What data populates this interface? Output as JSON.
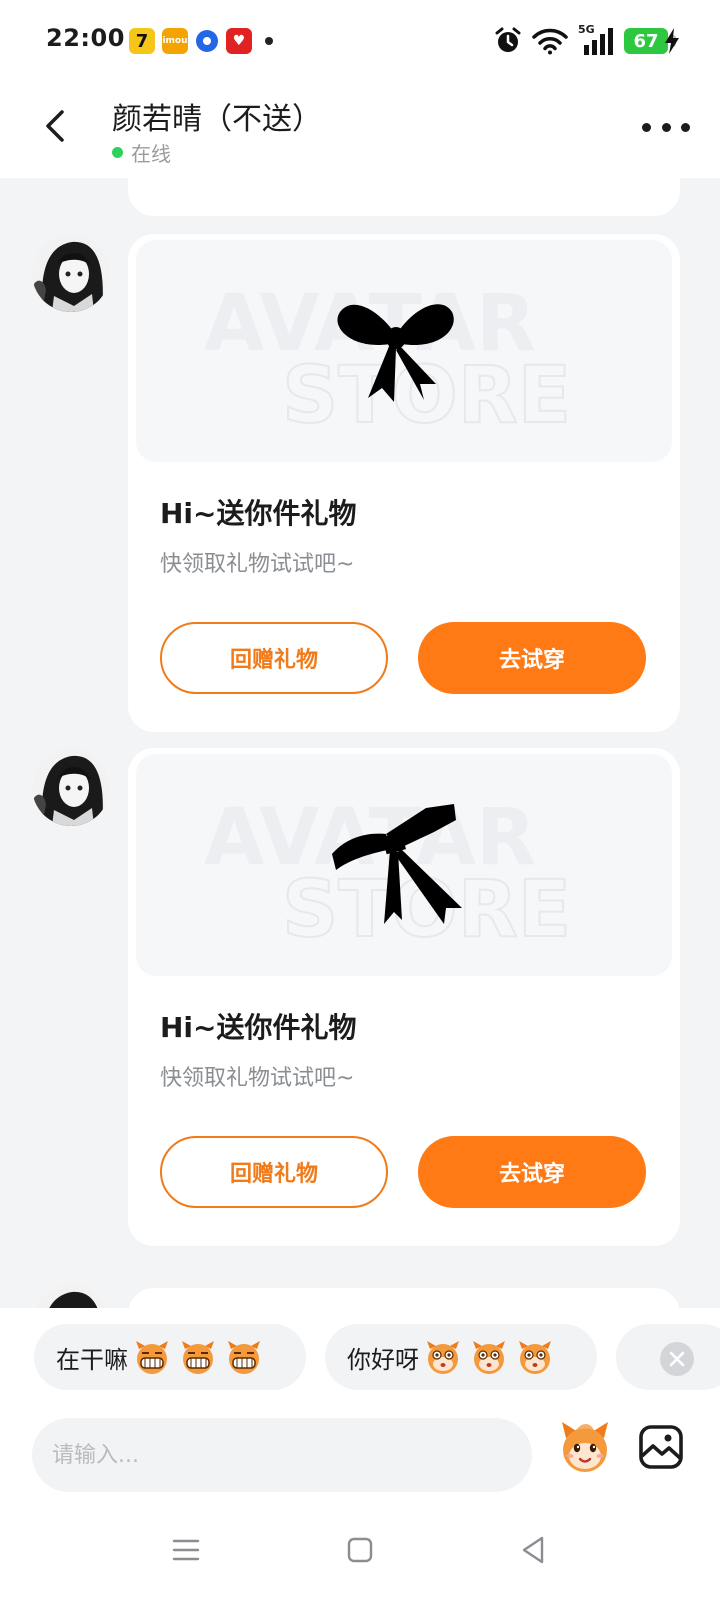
{
  "status_bar": {
    "time": "22:00",
    "notif_app1": "7",
    "notif_app2": "imou",
    "notif_app4": "♥",
    "network_label": "5G",
    "battery": "67"
  },
  "header": {
    "title": "颜若晴（不送）",
    "status": "在线"
  },
  "messages": [
    {
      "watermark_line1": "AVATAR",
      "watermark_line2": "STORE",
      "title": "Hi~送你件礼物",
      "subtitle": "快领取礼物试试吧~",
      "secondary_button": "回赠礼物",
      "primary_button": "去试穿"
    },
    {
      "watermark_line1": "AVATAR",
      "watermark_line2": "STORE",
      "title": "Hi~送你件礼物",
      "subtitle": "快领取礼物试试吧~",
      "secondary_button": "回赠礼物",
      "primary_button": "去试穿"
    }
  ],
  "quick_replies": [
    {
      "text": "在干嘛"
    },
    {
      "text": "你好呀"
    }
  ],
  "composer": {
    "placeholder": "请输入..."
  },
  "colors": {
    "accent": "#ff7a14",
    "online": "#2fd15a",
    "battery": "#2ec840"
  },
  "icons": [
    "back-arrow-icon",
    "more-dots-icon",
    "bow-icon",
    "emoji-sticker-icon",
    "image-icon",
    "close-icon",
    "menu-icon",
    "home-icon",
    "back-triangle-icon"
  ]
}
